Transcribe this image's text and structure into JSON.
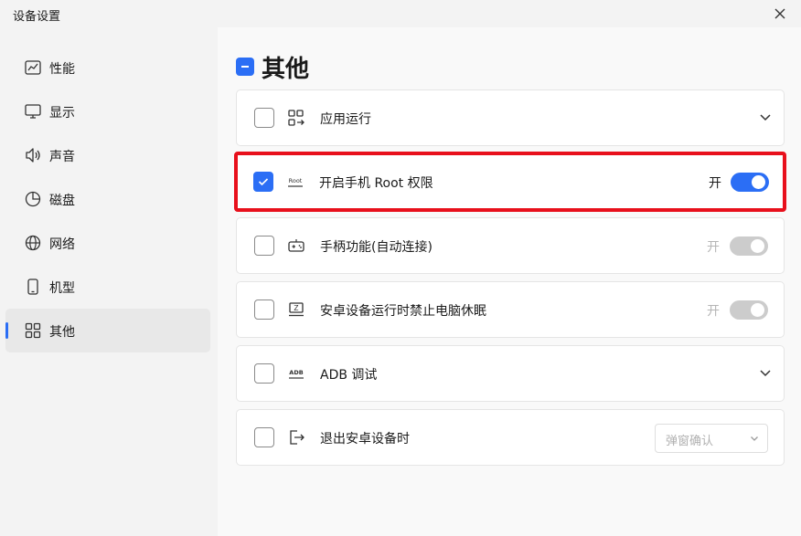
{
  "window": {
    "title": "设备设置"
  },
  "sidebar": {
    "items": [
      {
        "label": "性能",
        "icon": "performance-chart-icon"
      },
      {
        "label": "显示",
        "icon": "monitor-icon"
      },
      {
        "label": "声音",
        "icon": "speaker-icon"
      },
      {
        "label": "磁盘",
        "icon": "pie-disk-icon"
      },
      {
        "label": "网络",
        "icon": "globe-icon"
      },
      {
        "label": "机型",
        "icon": "phone-icon"
      },
      {
        "label": "其他",
        "icon": "grid-icon",
        "active": true
      }
    ]
  },
  "main": {
    "heading": "其他",
    "rows": [
      {
        "label": "应用运行",
        "icon": "app-run-icon",
        "checked": false,
        "control": "expand"
      },
      {
        "label": "开启手机 Root 权限",
        "icon": "root-icon",
        "icon_text": "Root",
        "checked": true,
        "control": "toggle",
        "state_label": "开",
        "toggle_on": true,
        "highlighted": true
      },
      {
        "label": "手柄功能(自动连接)",
        "icon": "gamepad-icon",
        "checked": false,
        "control": "toggle",
        "state_label": "开",
        "toggle_on": false
      },
      {
        "label": "安卓设备运行时禁止电脑休眠",
        "icon": "sleep-screen-icon",
        "icon_text": "Z",
        "checked": false,
        "control": "toggle",
        "state_label": "开",
        "toggle_on": false
      },
      {
        "label": "ADB 调试",
        "icon": "adb-icon",
        "icon_text": "ADB",
        "checked": false,
        "control": "expand"
      },
      {
        "label": "退出安卓设备时",
        "icon": "exit-icon",
        "checked": false,
        "control": "select",
        "select_value": "弹窗确认"
      }
    ]
  },
  "colors": {
    "accent": "#2b6ef5",
    "highlight_border": "#e8101c",
    "toggle_off": "#cccccc"
  }
}
